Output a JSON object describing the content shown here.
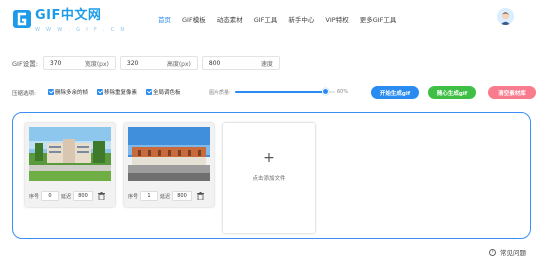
{
  "brand": {
    "name": "GIF中文网",
    "url": "W W W . G I F . C N",
    "color": "#1e9be8"
  },
  "nav": {
    "items": [
      {
        "label": "首页",
        "active": true
      },
      {
        "label": "GIF模板",
        "active": false
      },
      {
        "label": "动态素材",
        "active": false
      },
      {
        "label": "GIF工具",
        "active": false
      },
      {
        "label": "新手中心",
        "active": false
      },
      {
        "label": "VIP特权",
        "active": false
      },
      {
        "label": "更多GIF工具",
        "active": false
      }
    ]
  },
  "settings": {
    "label": "GIF设置:",
    "width": {
      "value": "370",
      "unit": "宽度(px)"
    },
    "height": {
      "value": "320",
      "unit": "高度(px)"
    },
    "speed": {
      "value": "800",
      "unit": "速度"
    }
  },
  "options": {
    "label": "压缩选项:",
    "checkboxes": [
      {
        "label": "删除多余的帧",
        "checked": true
      },
      {
        "label": "移除重复像素",
        "checked": true
      },
      {
        "label": "全局调色板",
        "checked": true
      }
    ],
    "quality": {
      "label": "图片质量:",
      "value_text": "60%",
      "value": 0.9
    }
  },
  "buttons": {
    "start": {
      "label": "开始生成gif",
      "color": "#2a8cf0"
    },
    "generate": {
      "label": "随心生成gif",
      "color": "#3fbf46"
    },
    "clear": {
      "label": "清空素材库",
      "color": "#f97b8e"
    }
  },
  "frames": [
    {
      "seq_label": "序号",
      "seq": "0",
      "delay_label": "延迟",
      "delay": "800"
    },
    {
      "seq_label": "序号",
      "seq": "1",
      "delay_label": "延迟",
      "delay": "800"
    }
  ],
  "add": {
    "plus": "+",
    "label": "点击添加文件"
  },
  "faq": {
    "label": "常见问题"
  },
  "colors": {
    "accent": "#2a8cf0",
    "border": "#3d8ff5"
  }
}
